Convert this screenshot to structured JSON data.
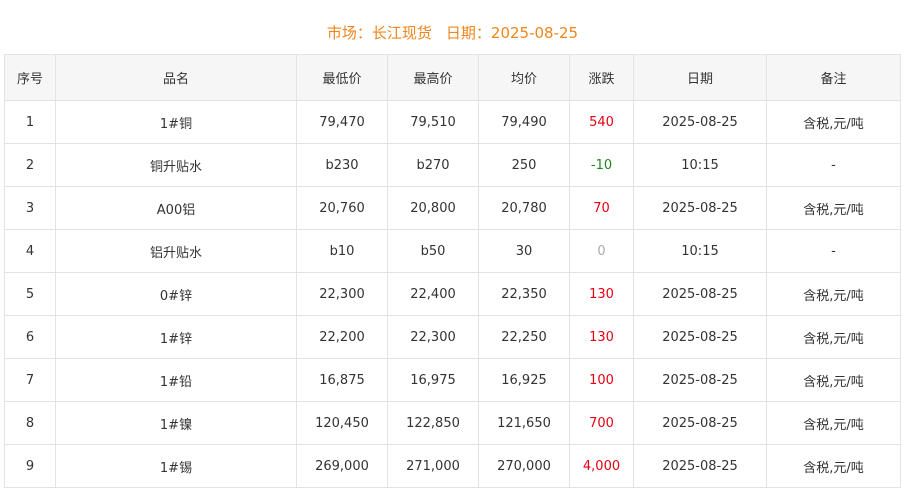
{
  "header": {
    "market_label": "市场：长江现货",
    "date_label": "日期：2025-08-25"
  },
  "colors": {
    "header_text": "#f0851a",
    "up": "#e60012",
    "down": "#1a8a1a",
    "flat": "#aaaaaa"
  },
  "table": {
    "columns": [
      "序号",
      "品名",
      "最低价",
      "最高价",
      "均价",
      "涨跌",
      "日期",
      "备注"
    ],
    "rows": [
      {
        "index": "1",
        "name": "1#铜",
        "low": "79,470",
        "high": "79,510",
        "avg": "79,490",
        "change": "540",
        "change_dir": "up",
        "date": "2025-08-25",
        "note": "含税,元/吨"
      },
      {
        "index": "2",
        "name": "铜升贴水",
        "low": "b230",
        "high": "b270",
        "avg": "250",
        "change": "-10",
        "change_dir": "down",
        "date": "10:15",
        "note": "-"
      },
      {
        "index": "3",
        "name": "A00铝",
        "low": "20,760",
        "high": "20,800",
        "avg": "20,780",
        "change": "70",
        "change_dir": "up",
        "date": "2025-08-25",
        "note": "含税,元/吨"
      },
      {
        "index": "4",
        "name": "铝升贴水",
        "low": "b10",
        "high": "b50",
        "avg": "30",
        "change": "0",
        "change_dir": "flat",
        "date": "10:15",
        "note": "-"
      },
      {
        "index": "5",
        "name": "0#锌",
        "low": "22,300",
        "high": "22,400",
        "avg": "22,350",
        "change": "130",
        "change_dir": "up",
        "date": "2025-08-25",
        "note": "含税,元/吨"
      },
      {
        "index": "6",
        "name": "1#锌",
        "low": "22,200",
        "high": "22,300",
        "avg": "22,250",
        "change": "130",
        "change_dir": "up",
        "date": "2025-08-25",
        "note": "含税,元/吨"
      },
      {
        "index": "7",
        "name": "1#铅",
        "low": "16,875",
        "high": "16,975",
        "avg": "16,925",
        "change": "100",
        "change_dir": "up",
        "date": "2025-08-25",
        "note": "含税,元/吨"
      },
      {
        "index": "8",
        "name": "1#镍",
        "low": "120,450",
        "high": "122,850",
        "avg": "121,650",
        "change": "700",
        "change_dir": "up",
        "date": "2025-08-25",
        "note": "含税,元/吨"
      },
      {
        "index": "9",
        "name": "1#锡",
        "low": "269,000",
        "high": "271,000",
        "avg": "270,000",
        "change": "4,000",
        "change_dir": "up",
        "date": "2025-08-25",
        "note": "含税,元/吨"
      }
    ]
  }
}
